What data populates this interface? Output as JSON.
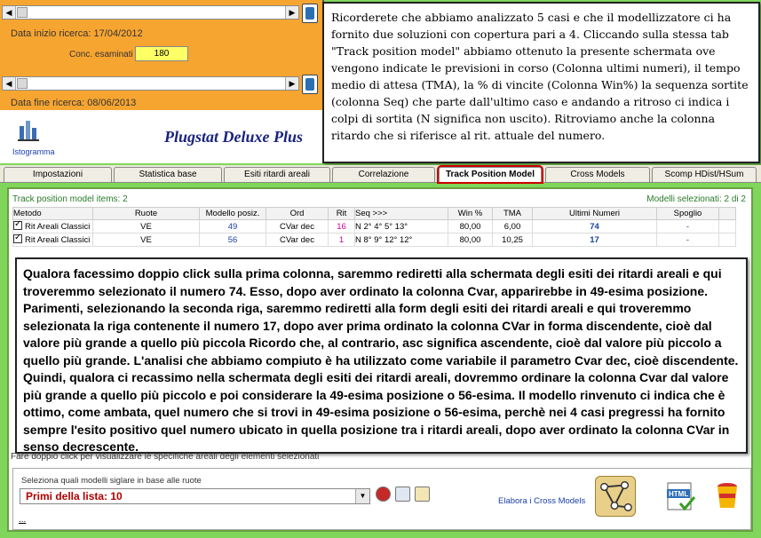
{
  "filters": {
    "data_inizio": "Data inizio ricerca: 17/04/2012",
    "conc_label": "Conc. esaminati",
    "conc_value": "180",
    "data_fine": "Data fine ricerca: 08/06/2013",
    "istogramma_label": "Istogramma",
    "brand": "Plugstat Deluxe Plus"
  },
  "note_top": "Ricorderete che abbiamo analizzato 5 casi e che il modellizzatore ci ha fornito due soluzioni con copertura pari a 4. Cliccando sulla stessa tab \"Track position model\" abbiamo ottenuto la presente schermata ove vengono indicate le previsioni in corso (Colonna ultimi numeri), il tempo medio di attesa (TMA), la % di vincite (Colonna Win%) la sequenza sortite (colonna Seq) che parte dall'ultimo caso e andando a ritroso ci indica i colpi di sortita (N significa non uscito). Ritroviamo anche la colonna ritardo che si riferisce al rit. attuale del numero.",
  "tabs": [
    {
      "label": "Impostazioni"
    },
    {
      "label": "Statistica base"
    },
    {
      "label": "Esiti ritardi areali"
    },
    {
      "label": "Correlazione"
    },
    {
      "label": "Track Position Model"
    },
    {
      "label": "Cross Models"
    },
    {
      "label": "Scomp HDist/HSum"
    }
  ],
  "main": {
    "items_count": "Track position model items: 2",
    "models_selected": "Modelli selezionati: 2 di 2",
    "columns": [
      "Metodo",
      "Ruote",
      "Modello posiz.",
      "Ord",
      "Rit",
      "Seq >>>",
      "Win %",
      "TMA",
      "Ultimi Numeri",
      "Spoglio"
    ],
    "rows": [
      {
        "metodo": "Rit Areali Classici",
        "ruote": "VE",
        "modello": "49",
        "ord": "CVar dec",
        "rit": "16",
        "seq": "N 2° 4° 5° 13°",
        "win": "80,00",
        "tma": "6,00",
        "ultimi": "74",
        "spoglio": "-"
      },
      {
        "metodo": "Rit Areali Classici",
        "ruote": "VE",
        "modello": "56",
        "ord": "CVar dec",
        "rit": "1",
        "seq": "N 8° 9° 12° 12°",
        "win": "80,00",
        "tma": "10,25",
        "ultimi": "17",
        "spoglio": "-"
      }
    ],
    "hint": "Fare doppio click per visualizzare le specifiche areali degli elementi selezionati"
  },
  "note_main": "Qualora facessimo doppio click sulla prima colonna, saremmo rediretti alla schermata degli esiti dei ritardi areali e qui troveremmo selezionato il numero 74. Esso, dopo aver ordinato la colonna Cvar, apparirebbe in 49-esima posizione. Parimenti, selezionando la seconda riga, saremmo rediretti alla form degli esiti dei ritardi areali e qui troveremmo selezionata la riga contenente il numero 17, dopo aver prima ordinato la colonna CVar in forma discendente, cioè dal valore più grande a quello più piccola Ricordo che, al contrario, asc significa ascendente, cioè dal valore più piccolo a quello più grande. L'analisi che abbiamo compiuto è ha utilizzato come variabile il parametro Cvar dec, cioè discendente. Quindi, qualora ci recassimo nella schermata degli esiti dei ritardi areali, dovremmo ordinare la colonna Cvar dal valore più grande a quello più piccolo e poi considerare la 49-esima posizione o 56-esima. Il modello rinvenuto ci indica che è ottimo, come ambata, quel numero che si trovi in 49-esima posizione o 56-esima, perchè nei 4 casi pregressi ha fornito sempre l'esito positivo quel numero ubicato in quella posizione tra i ritardi areali, dopo aver ordinato la colonna CVar in senso decrescente.",
  "bottom": {
    "select_label": "Seleziona quali modelli siglare in base alle ruote",
    "dropdown_value": "Primi della lista: 10",
    "elabora_label": "Elabora i Cross Models",
    "ellipsis": "..."
  },
  "colors": {
    "orange_panel": "#f7a531",
    "green_bg": "#7fd65a",
    "active_tab_outline": "#cc0000",
    "link_blue": "#1a3fa8"
  }
}
